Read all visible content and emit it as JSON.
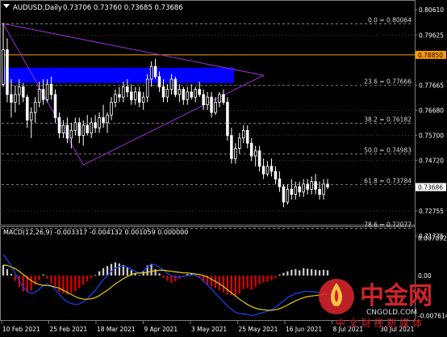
{
  "header": {
    "symbol": "AUDUSD,Daily",
    "ohlc": "0.73706 0.73760 0.73685 0.73686"
  },
  "macd_panel": {
    "label": "MACD(12,26,9) -0.003317 -0.004132 0.001059 0.000000"
  },
  "watermark": {
    "brand": "中金网",
    "domain": "CNGOLD.COM",
    "slogan": "中 文 财 经 新 媒 体"
  },
  "colors": {
    "background": "#000000",
    "candle": "#ffffff",
    "grid": "#7f7f7f",
    "fib_line": "#c8c8c8",
    "support_line": "#ff9a00",
    "zone": "#0000ff",
    "triangle": "#9a2fd6",
    "macd_hist_pos": "#cccccc",
    "macd_hist_neg": "#e00000",
    "macd_line": "#1f3fff",
    "signal_line": "#e8d000",
    "watermark_red": "#d2232a"
  },
  "chart_data": [
    {
      "type": "candlestick",
      "title": "AUDUSD,Daily",
      "ylim": [
        0.7225,
        0.8055
      ],
      "y_ticks": [
        "0.80610",
        "0.79625",
        "0.78850",
        "0.77665",
        "0.76680",
        "0.75700",
        "0.74720",
        "0.73686",
        "0.72755",
        "0.71775"
      ],
      "x_ticks": [
        "10 Feb 2021",
        "25 Feb 2021",
        "18 Mar 2021",
        "9 Apr 2021",
        "3 May 2021",
        "25 May 2021",
        "16 Jun 2021",
        "8 Jul 2021",
        "30 Jul 2021"
      ],
      "current_price": 0.73686,
      "fibonacci_levels": [
        {
          "label": "0.0 = 0.80064",
          "value": 0.80064
        },
        {
          "label": "23.6 = 0.77666",
          "value": 0.77666
        },
        {
          "label": "38.2 = 0.76182",
          "value": 0.76182
        },
        {
          "label": "50.0 = 0.74983",
          "value": 0.74983
        },
        {
          "label": "61.8 = 0.73784",
          "value": 0.73784
        },
        {
          "label": "78.6 = 0.72077",
          "value": 0.72077
        }
      ],
      "horizontal_line": {
        "label": "0.78850",
        "value": 0.7885
      },
      "zone": {
        "from": 0.7775,
        "to": 0.7835
      },
      "triangle": [
        {
          "bar": 0,
          "price": 0.8007
        },
        {
          "bar": 65,
          "price": 0.7805
        },
        {
          "bar": 20,
          "price": 0.7455
        }
      ],
      "candles": [
        [
          0.777,
          0.801,
          0.776,
          0.7905
        ],
        [
          0.7905,
          0.795,
          0.77,
          0.773
        ],
        [
          0.773,
          0.779,
          0.764,
          0.77
        ],
        [
          0.77,
          0.7765,
          0.766,
          0.773
        ],
        [
          0.773,
          0.779,
          0.769,
          0.776
        ],
        [
          0.776,
          0.7775,
          0.77,
          0.772
        ],
        [
          0.772,
          0.773,
          0.76,
          0.763
        ],
        [
          0.763,
          0.768,
          0.756,
          0.766
        ],
        [
          0.766,
          0.772,
          0.762,
          0.77
        ],
        [
          0.77,
          0.778,
          0.768,
          0.775
        ],
        [
          0.775,
          0.779,
          0.769,
          0.771
        ],
        [
          0.771,
          0.779,
          0.77,
          0.777
        ],
        [
          0.777,
          0.78,
          0.771,
          0.773
        ],
        [
          0.773,
          0.775,
          0.762,
          0.764
        ],
        [
          0.764,
          0.766,
          0.756,
          0.758
        ],
        [
          0.758,
          0.763,
          0.756,
          0.761
        ],
        [
          0.761,
          0.764,
          0.754,
          0.756
        ],
        [
          0.756,
          0.762,
          0.752,
          0.759
        ],
        [
          0.759,
          0.764,
          0.757,
          0.762
        ],
        [
          0.762,
          0.764,
          0.754,
          0.757
        ],
        [
          0.757,
          0.763,
          0.753,
          0.761
        ],
        [
          0.761,
          0.765,
          0.757,
          0.758
        ],
        [
          0.758,
          0.764,
          0.756,
          0.762
        ],
        [
          0.762,
          0.765,
          0.758,
          0.76
        ],
        [
          0.76,
          0.766,
          0.758,
          0.764
        ],
        [
          0.764,
          0.769,
          0.76,
          0.762
        ],
        [
          0.762,
          0.766,
          0.758,
          0.765
        ],
        [
          0.765,
          0.772,
          0.763,
          0.77
        ],
        [
          0.77,
          0.775,
          0.768,
          0.773
        ],
        [
          0.773,
          0.776,
          0.77,
          0.772
        ],
        [
          0.772,
          0.778,
          0.77,
          0.776
        ],
        [
          0.776,
          0.779,
          0.772,
          0.774
        ],
        [
          0.774,
          0.777,
          0.769,
          0.771
        ],
        [
          0.771,
          0.776,
          0.769,
          0.774
        ],
        [
          0.774,
          0.776,
          0.768,
          0.77
        ],
        [
          0.77,
          0.774,
          0.767,
          0.772
        ],
        [
          0.772,
          0.781,
          0.77,
          0.779
        ],
        [
          0.779,
          0.786,
          0.776,
          0.784
        ],
        [
          0.784,
          0.787,
          0.779,
          0.78
        ],
        [
          0.78,
          0.782,
          0.774,
          0.776
        ],
        [
          0.776,
          0.779,
          0.77,
          0.772
        ],
        [
          0.772,
          0.777,
          0.77,
          0.775
        ],
        [
          0.775,
          0.781,
          0.773,
          0.779
        ],
        [
          0.779,
          0.78,
          0.772,
          0.773
        ],
        [
          0.773,
          0.777,
          0.77,
          0.775
        ],
        [
          0.775,
          0.776,
          0.769,
          0.771
        ],
        [
          0.771,
          0.776,
          0.769,
          0.774
        ],
        [
          0.774,
          0.777,
          0.771,
          0.772
        ],
        [
          0.772,
          0.776,
          0.77,
          0.775
        ],
        [
          0.775,
          0.778,
          0.772,
          0.773
        ],
        [
          0.773,
          0.775,
          0.767,
          0.769
        ],
        [
          0.769,
          0.774,
          0.767,
          0.772
        ],
        [
          0.772,
          0.774,
          0.764,
          0.766
        ],
        [
          0.766,
          0.772,
          0.765,
          0.77
        ],
        [
          0.77,
          0.774,
          0.768,
          0.773
        ],
        [
          0.773,
          0.775,
          0.769,
          0.77
        ],
        [
          0.77,
          0.772,
          0.755,
          0.757
        ],
        [
          0.757,
          0.76,
          0.746,
          0.748
        ],
        [
          0.748,
          0.754,
          0.746,
          0.752
        ],
        [
          0.752,
          0.758,
          0.75,
          0.756
        ],
        [
          0.756,
          0.761,
          0.754,
          0.759
        ],
        [
          0.759,
          0.761,
          0.752,
          0.754
        ],
        [
          0.754,
          0.756,
          0.747,
          0.749
        ],
        [
          0.749,
          0.753,
          0.745,
          0.751
        ],
        [
          0.751,
          0.753,
          0.743,
          0.745
        ],
        [
          0.745,
          0.748,
          0.74,
          0.742
        ],
        [
          0.742,
          0.747,
          0.741,
          0.745
        ],
        [
          0.745,
          0.748,
          0.741,
          0.743
        ],
        [
          0.743,
          0.745,
          0.738,
          0.74
        ],
        [
          0.74,
          0.743,
          0.735,
          0.737
        ],
        [
          0.737,
          0.738,
          0.729,
          0.731
        ],
        [
          0.731,
          0.738,
          0.73,
          0.736
        ],
        [
          0.736,
          0.74,
          0.732,
          0.734
        ],
        [
          0.734,
          0.739,
          0.732,
          0.737
        ],
        [
          0.737,
          0.739,
          0.733,
          0.735
        ],
        [
          0.735,
          0.74,
          0.733,
          0.738
        ],
        [
          0.738,
          0.74,
          0.734,
          0.736
        ],
        [
          0.736,
          0.741,
          0.734,
          0.739
        ],
        [
          0.739,
          0.742,
          0.734,
          0.736
        ],
        [
          0.736,
          0.739,
          0.732,
          0.734
        ],
        [
          0.734,
          0.74,
          0.732,
          0.738
        ],
        [
          0.738,
          0.74,
          0.736,
          0.7369
        ]
      ]
    },
    {
      "type": "bar+line",
      "title": "MACD(12,26,9)",
      "ylim": [
        -0.0083,
        0.0072
      ],
      "y_ticks": [
        "0.007092",
        "0.00",
        "-0.007614"
      ],
      "histogram": [
        0.002,
        0.0012,
        0.0003,
        -0.001,
        -0.0022,
        -0.003,
        -0.0032,
        -0.0028,
        -0.0018,
        -0.0009,
        0.0002,
        -0.0006,
        -0.0015,
        -0.002,
        -0.0031,
        -0.0034,
        -0.0036,
        -0.0033,
        -0.003,
        -0.0024,
        -0.0018,
        -0.0011,
        -0.0005,
        0.0001,
        0.0008,
        0.0014,
        0.0018,
        0.0022,
        0.0025,
        0.0023,
        0.002,
        0.0015,
        0.001,
        0.0005,
        0.0001,
        0.0009,
        0.0019,
        0.0022,
        0.0012,
        0.0004,
        -0.0004,
        -0.001,
        -0.0014,
        -0.0011,
        -0.0006,
        -0.0002,
        0.0003,
        0.0004,
        0.0001,
        -0.0004,
        -0.0012,
        -0.0018,
        -0.0021,
        -0.0024,
        -0.0028,
        -0.0032,
        -0.0036,
        -0.0037,
        -0.004,
        -0.0034,
        -0.0026,
        -0.0024,
        -0.0027,
        -0.0022,
        -0.0016,
        -0.0013,
        -0.0012,
        -0.0009,
        -0.0005,
        0.0002,
        0.0005,
        0.0008,
        0.0011,
        0.0012,
        0.001,
        0.0014,
        0.0013,
        0.0012,
        0.0011,
        0.001,
        0.0011,
        0.001
      ],
      "macd": [
        0.004,
        0.003,
        0.0018,
        0.0004,
        -0.001,
        -0.0022,
        -0.003,
        -0.0034,
        -0.0032,
        -0.0026,
        -0.0018,
        -0.0016,
        -0.002,
        -0.0026,
        -0.0036,
        -0.0044,
        -0.005,
        -0.0053,
        -0.0055,
        -0.0054,
        -0.005,
        -0.0044,
        -0.0036,
        -0.0028,
        -0.0018,
        -0.0008,
        0.0,
        0.0008,
        0.0014,
        0.0017,
        0.0018,
        0.0016,
        0.0012,
        0.0008,
        0.0004,
        0.0008,
        0.0016,
        0.0022,
        0.002,
        0.0016,
        0.001,
        0.0004,
        -0.0001,
        -0.0003,
        -0.0003,
        -0.0002,
        0.0,
        0.0001,
        0.0,
        -0.0004,
        -0.001,
        -0.0018,
        -0.0026,
        -0.0034,
        -0.0042,
        -0.005,
        -0.0058,
        -0.0064,
        -0.007,
        -0.0072,
        -0.0073,
        -0.0074,
        -0.0076,
        -0.0075,
        -0.0072,
        -0.007,
        -0.0068,
        -0.0065,
        -0.006,
        -0.0054,
        -0.0048,
        -0.0042,
        -0.0038,
        -0.0034,
        -0.0033,
        -0.003,
        -0.003,
        -0.0031,
        -0.0031,
        -0.0032,
        -0.0032,
        -0.0033
      ],
      "signal": [
        0.002,
        0.0019,
        0.0016,
        0.0013,
        0.0008,
        0.0002,
        -0.0004,
        -0.001,
        -0.0014,
        -0.0017,
        -0.0019,
        -0.0019,
        -0.002,
        -0.0022,
        -0.0024,
        -0.0028,
        -0.0032,
        -0.0036,
        -0.004,
        -0.0043,
        -0.0045,
        -0.0045,
        -0.0044,
        -0.0042,
        -0.0038,
        -0.0033,
        -0.0028,
        -0.0022,
        -0.0016,
        -0.0011,
        -0.0006,
        -0.0002,
        0.0002,
        0.0004,
        0.0005,
        0.0005,
        0.0006,
        0.0008,
        0.0009,
        0.001,
        0.001,
        0.0009,
        0.0008,
        0.0007,
        0.0006,
        0.0005,
        0.0005,
        0.0004,
        0.0003,
        0.0002,
        0.0,
        -0.0003,
        -0.0007,
        -0.0011,
        -0.0016,
        -0.0021,
        -0.0027,
        -0.0033,
        -0.0039,
        -0.0045,
        -0.005,
        -0.0055,
        -0.0059,
        -0.0062,
        -0.0064,
        -0.0065,
        -0.0066,
        -0.0066,
        -0.0065,
        -0.0063,
        -0.006,
        -0.0056,
        -0.0052,
        -0.0048,
        -0.0045,
        -0.0042,
        -0.004,
        -0.0039,
        -0.0038,
        -0.0037,
        -0.0036,
        -0.0035
      ]
    }
  ]
}
